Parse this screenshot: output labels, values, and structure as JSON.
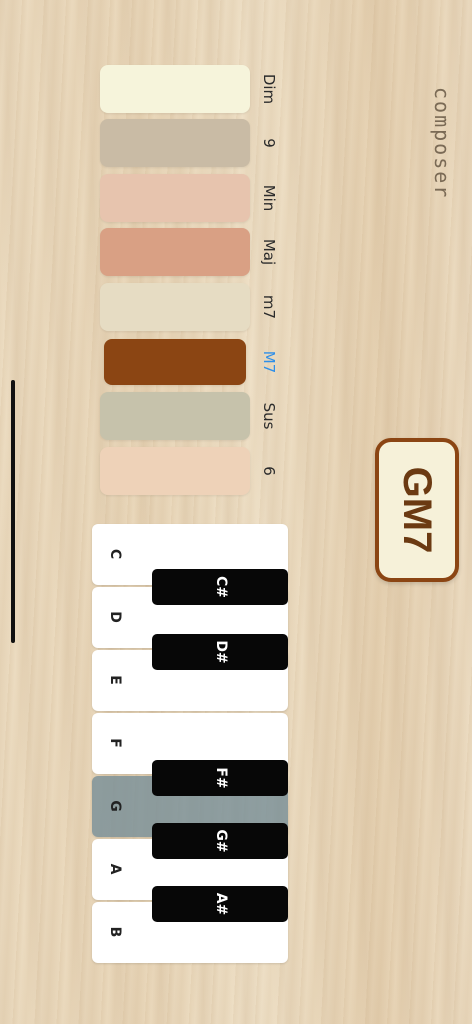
{
  "app": {
    "title": "composer"
  },
  "chord": {
    "display": "GM7"
  },
  "qualities": [
    {
      "label": "Dim",
      "color": "#f6f4db",
      "selected": false
    },
    {
      "label": "9",
      "color": "#c9bba5",
      "selected": false
    },
    {
      "label": "Min",
      "color": "#e7c4ae",
      "selected": false
    },
    {
      "label": "Maj",
      "color": "#d9a084",
      "selected": false
    },
    {
      "label": "m7",
      "color": "#e6dcc3",
      "selected": false
    },
    {
      "label": "M7",
      "color": "#8b4513",
      "selected": true
    },
    {
      "label": "Sus",
      "color": "#c6c2ab",
      "selected": false
    },
    {
      "label": "6",
      "color": "#eed2b8",
      "selected": false
    }
  ],
  "keyboard": {
    "white_keys": [
      {
        "note": "C",
        "active": false
      },
      {
        "note": "D",
        "active": false
      },
      {
        "note": "E",
        "active": false
      },
      {
        "note": "F",
        "active": false
      },
      {
        "note": "G",
        "active": true
      },
      {
        "note": "A",
        "active": false
      },
      {
        "note": "B",
        "active": false
      }
    ],
    "black_keys": [
      "C#",
      "D#",
      "F#",
      "G#",
      "A#"
    ]
  },
  "colors": {
    "accent": "#8b4513",
    "selected_label": "#2f8fe8",
    "chord_bg": "#f6f1d9"
  }
}
